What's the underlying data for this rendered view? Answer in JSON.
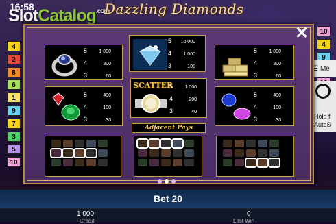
{
  "status": {
    "time": "16:58"
  },
  "watermark": {
    "slot": "Slot",
    "catalog": "Catalog",
    "com": ".com"
  },
  "game": {
    "title": "Dazzling Diamonds"
  },
  "lines_left": [
    {
      "n": "4",
      "color": "#f4d21d"
    },
    {
      "n": "2",
      "color": "#e8483c"
    },
    {
      "n": "8",
      "color": "#f28c28"
    },
    {
      "n": "6",
      "color": "#a8e05a"
    },
    {
      "n": "1",
      "color": "#f4e36a"
    },
    {
      "n": "9",
      "color": "#69d0f0"
    },
    {
      "n": "7",
      "color": "#f4d21d"
    },
    {
      "n": "3",
      "color": "#4fd06a"
    },
    {
      "n": "5",
      "color": "#b892e8"
    },
    {
      "n": "10",
      "color": "#f0a3d8"
    }
  ],
  "lines_right": [
    {
      "n": "10",
      "color": "#f0a3d8"
    },
    {
      "n": "4",
      "color": "#f4d21d"
    },
    {
      "n": "9",
      "color": "#69d0f0"
    },
    {
      "n": "9",
      "color": "#69d0f0"
    },
    {
      "n": "10",
      "color": "#f0a3d8"
    }
  ],
  "paytable": {
    "cells": [
      {
        "symbol": "ring-icon",
        "pays": [
          {
            "n": "5",
            "v": "1 000"
          },
          {
            "n": "4",
            "v": "300"
          },
          {
            "n": "3",
            "v": "60"
          }
        ]
      },
      {
        "symbol": "diamond-icon",
        "pays": [
          {
            "n": "5",
            "v": "10 000"
          },
          {
            "n": "4",
            "v": "1 000"
          },
          {
            "n": "3",
            "v": "100"
          }
        ]
      },
      {
        "symbol": "gold-bars-icon",
        "pays": [
          {
            "n": "5",
            "v": "1 000"
          },
          {
            "n": "4",
            "v": "300"
          },
          {
            "n": "3",
            "v": "60"
          }
        ]
      },
      {
        "symbol": "ruby-emerald-icon",
        "pays": [
          {
            "n": "5",
            "v": "400"
          },
          {
            "n": "4",
            "v": "100"
          },
          {
            "n": "3",
            "v": "30"
          }
        ]
      },
      {
        "symbol": "scatter-watch-icon",
        "label": "SCATTER",
        "pays": [
          {
            "n": "5",
            "v": "1 000"
          },
          {
            "n": "4",
            "v": "200"
          },
          {
            "n": "3",
            "v": "40"
          }
        ]
      },
      {
        "symbol": "sapphire-amethyst-icon",
        "pays": [
          {
            "n": "5",
            "v": "400"
          },
          {
            "n": "4",
            "v": "100"
          },
          {
            "n": "3",
            "v": "30"
          }
        ]
      }
    ],
    "adjacent_label": "Adjacent Pays"
  },
  "footer": {
    "bet": "Bet 20",
    "credit_value": "1 000",
    "credit_label": "Credit",
    "win_value": "0",
    "win_label": "Last Win"
  },
  "side": {
    "menu": "Me",
    "hold1": "Hold f",
    "hold2": "AutoS"
  },
  "colors": {
    "accent_gold": "#c89b4a",
    "panel": "#5d3a76"
  }
}
